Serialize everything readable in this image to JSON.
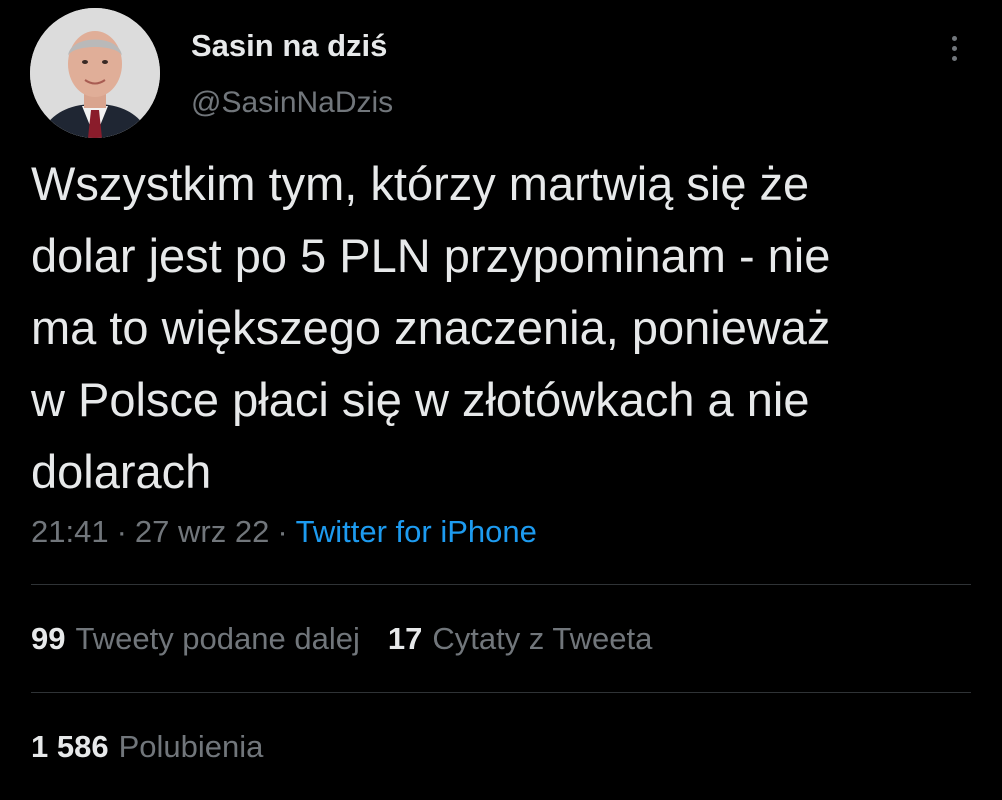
{
  "user": {
    "display_name": "Sasin na dziś",
    "handle": "@SasinNaDzis",
    "avatar_icon": "profile-photo"
  },
  "tweet": {
    "text": "Wszystkim tym, którzy martwią się że\ndolar jest po 5 PLN przypominam - nie\nma to większego znaczenia, ponieważ\nw Polsce płaci się w złotówkach a nie\ndolarach",
    "time": "21:41",
    "date": "27 wrz 22",
    "separator": "·",
    "source": "Twitter for iPhone"
  },
  "stats": {
    "retweets": {
      "count": "99",
      "label": "Tweety podane dalej"
    },
    "quotes": {
      "count": "17",
      "label": "Cytaty z Tweeta"
    },
    "likes": {
      "count": "1 586",
      "label": "Polubienia"
    }
  },
  "colors": {
    "background": "#000000",
    "primary_text": "#e7e9ea",
    "secondary_text": "#71767b",
    "link": "#1d9bf0",
    "divider": "#2f3336"
  },
  "icons": {
    "more": "more-vertical-icon"
  }
}
